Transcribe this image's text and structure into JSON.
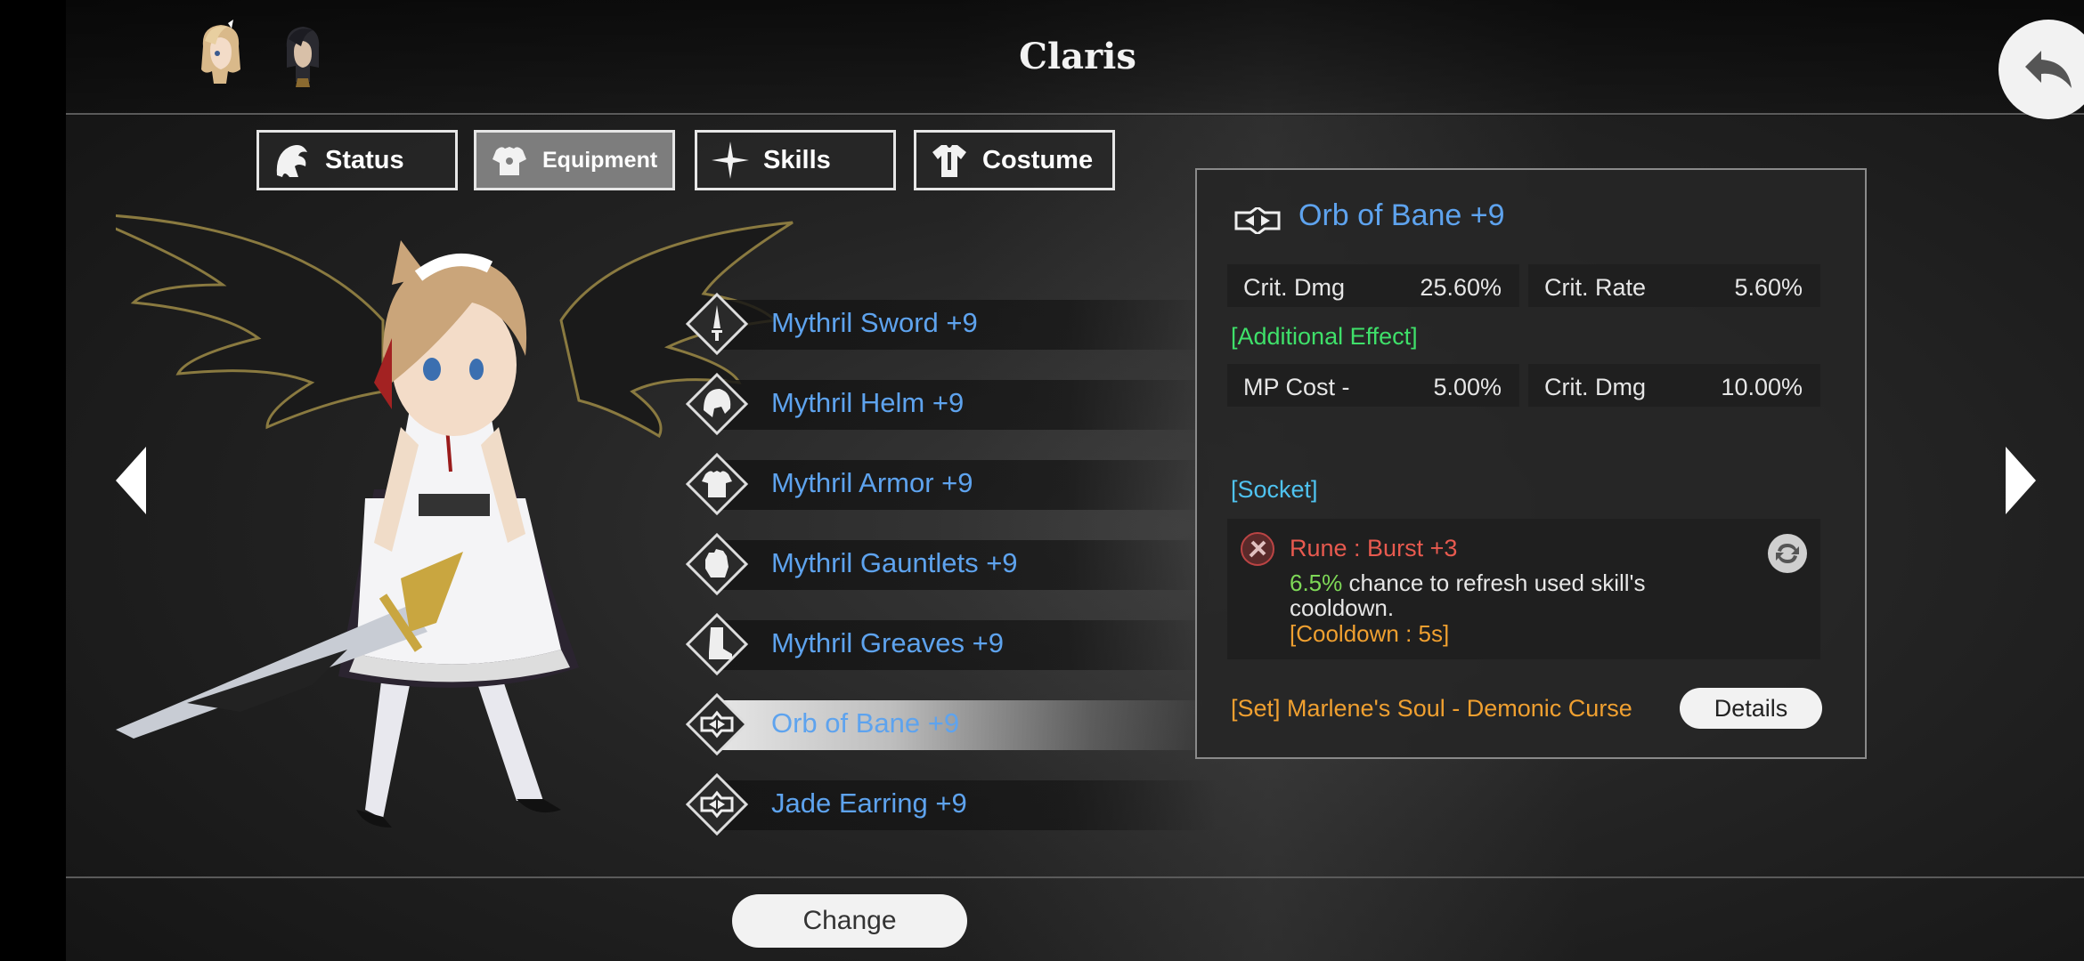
{
  "header": {
    "title": "Claris",
    "portraits": [
      "claris-portrait",
      "dark-hair-portrait"
    ]
  },
  "tabs": [
    {
      "label": "Status",
      "icon": "lion-crest-icon"
    },
    {
      "label": "Equipment",
      "icon": "armor-icon",
      "active": true
    },
    {
      "label": "Skills",
      "icon": "sparkle-star-icon"
    },
    {
      "label": "Costume",
      "icon": "shirt-icon"
    }
  ],
  "equipment": [
    {
      "label": "Mythril Sword +9",
      "icon": "sword-icon"
    },
    {
      "label": "Mythril Helm +9",
      "icon": "helm-icon"
    },
    {
      "label": "Mythril Armor +9",
      "icon": "armor-icon"
    },
    {
      "label": "Mythril Gauntlets +9",
      "icon": "gauntlet-icon"
    },
    {
      "label": "Mythril Greaves +9",
      "icon": "boot-icon"
    },
    {
      "label": "Orb of Bane +9",
      "icon": "accessory-icon",
      "selected": true
    },
    {
      "label": "Jade Earring +9",
      "icon": "accessory-icon"
    }
  ],
  "detail": {
    "name": "Orb of Bane +9",
    "base_stats": [
      {
        "label": "Crit. Dmg",
        "value": "25.60%"
      },
      {
        "label": "Crit. Rate",
        "value": "5.60%"
      }
    ],
    "additional_label": "[Additional Effect]",
    "additional_stats": [
      {
        "label": "MP Cost -",
        "value": "5.00%"
      },
      {
        "label": "Crit. Dmg",
        "value": "10.00%"
      }
    ],
    "socket_label": "[Socket]",
    "rune": {
      "name": "Rune : Burst +3",
      "percent": "6.5%",
      "description": " chance to refresh used skill's cooldown.",
      "cooldown": "[Cooldown : 5s]"
    },
    "set_label": "[Set] Marlene's Soul - Demonic Curse",
    "details_button": "Details"
  },
  "change_button": "Change",
  "colors": {
    "item_blue": "#5ea3ee",
    "additional_green": "#3fe06a",
    "socket_cyan": "#4fc3f0",
    "rune_red": "#e85a4f",
    "set_orange": "#f0a030"
  }
}
